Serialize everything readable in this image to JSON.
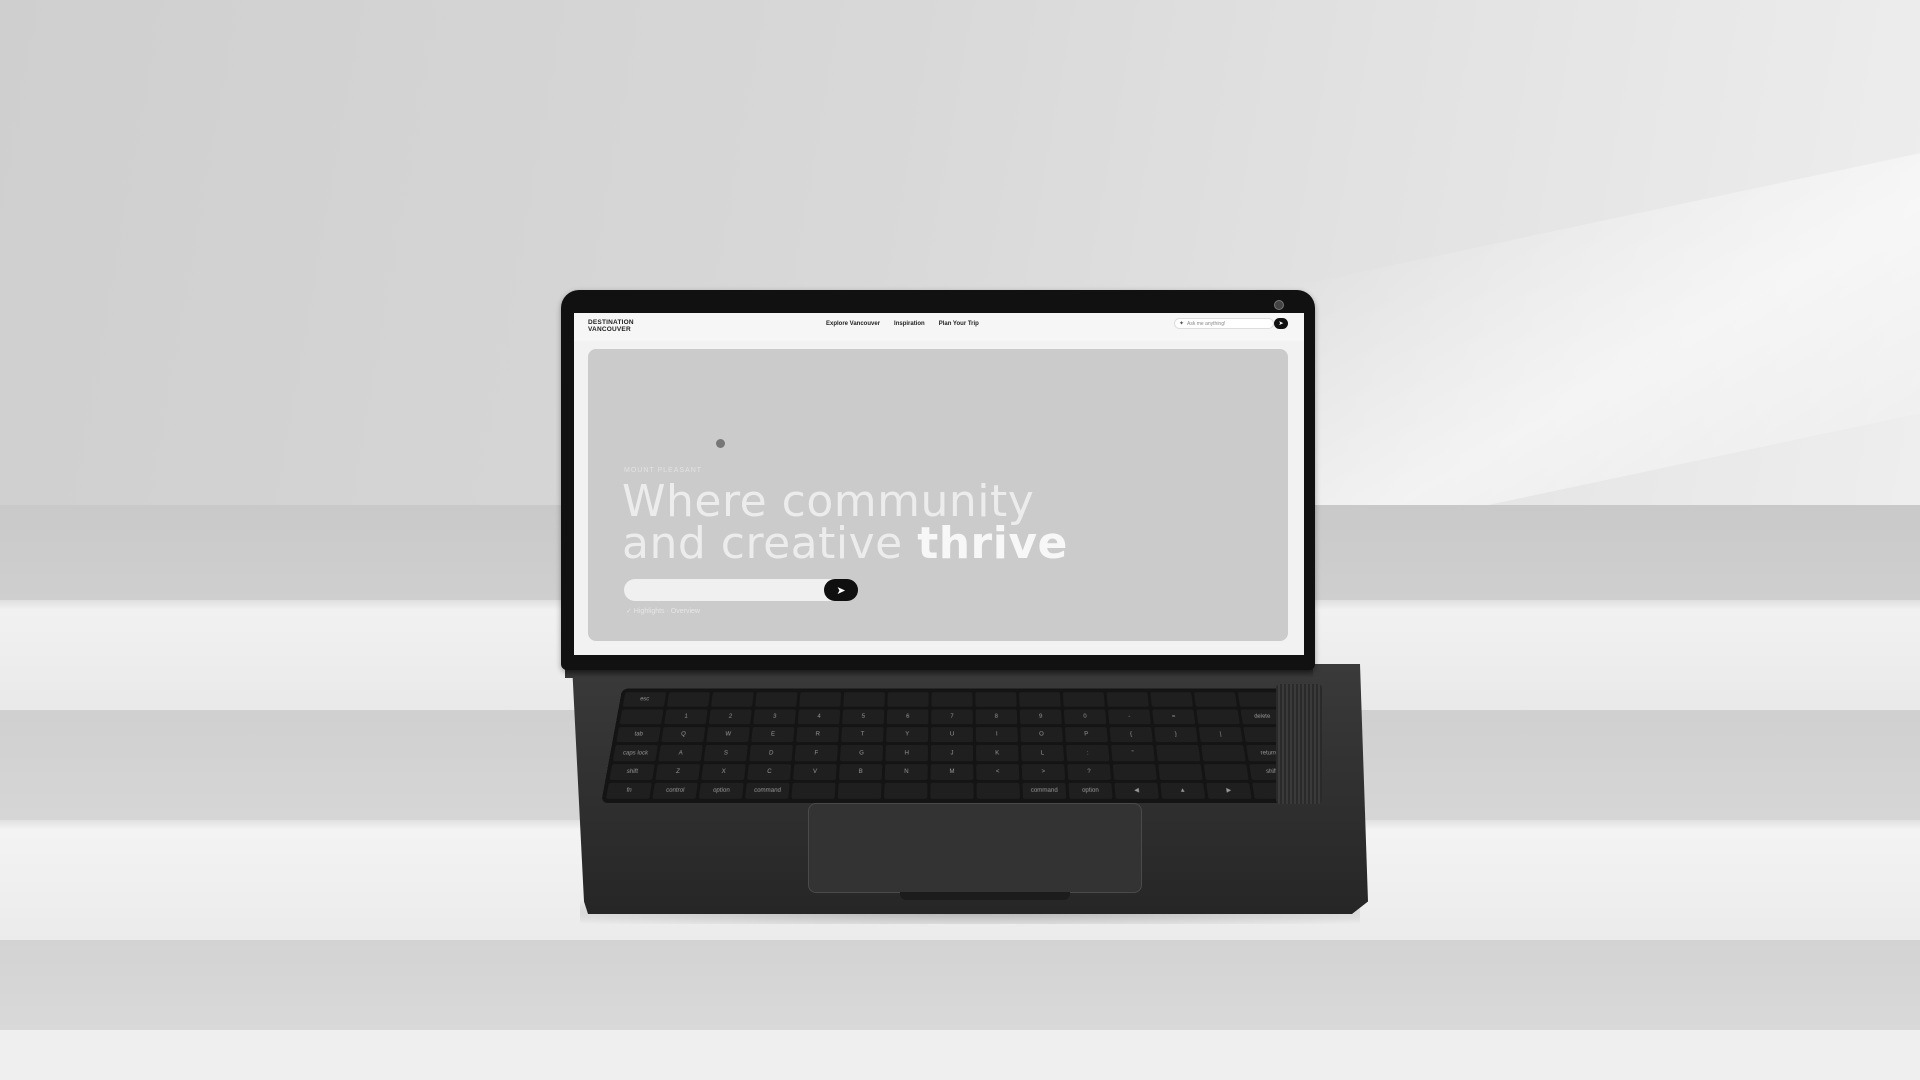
{
  "site": {
    "logo_line1": "DESTINATION",
    "logo_line2": "VANCOUVER",
    "nav": [
      "Explore Vancouver",
      "Inspiration",
      "Plan Your Trip"
    ],
    "ask_placeholder": "Ask me anything!",
    "ask_spark_icon": "sparkle-icon",
    "send_icon": "paper-plane-icon"
  },
  "hero": {
    "eyebrow": "MOUNT PLEASANT",
    "title_line1": "Where community",
    "title_line2_plain": "and creative ",
    "title_line2_bold": "thrive",
    "search_placeholder": "",
    "tags": "✓ Highlights · Overview"
  },
  "colors": {
    "accent_dark": "#111111",
    "hero_bg": "#cbcbcb",
    "wall": "#d6d6d6"
  }
}
